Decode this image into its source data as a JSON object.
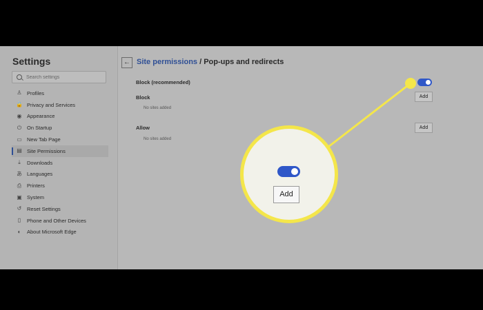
{
  "sidebar": {
    "title": "Settings",
    "search_placeholder": "Search settings",
    "items": [
      {
        "label": "Profiles",
        "icon": "person-icon",
        "glyph": "♙"
      },
      {
        "label": "Privacy and Services",
        "icon": "lock-icon",
        "glyph": "🔒"
      },
      {
        "label": "Appearance",
        "icon": "palette-icon",
        "glyph": "◉"
      },
      {
        "label": "On Startup",
        "icon": "power-icon",
        "glyph": "⏻"
      },
      {
        "label": "New Tab Page",
        "icon": "tab-icon",
        "glyph": "▭"
      },
      {
        "label": "Site Permissions",
        "icon": "permissions-icon",
        "glyph": "▤",
        "active": true
      },
      {
        "label": "Downloads",
        "icon": "download-icon",
        "glyph": "⤓"
      },
      {
        "label": "Languages",
        "icon": "language-icon",
        "glyph": "あ"
      },
      {
        "label": "Printers",
        "icon": "printer-icon",
        "glyph": "⎙"
      },
      {
        "label": "System",
        "icon": "system-icon",
        "glyph": "▣"
      },
      {
        "label": "Reset Settings",
        "icon": "reset-icon",
        "glyph": "↺"
      },
      {
        "label": "Phone and Other Devices",
        "icon": "phone-icon",
        "glyph": "▯"
      },
      {
        "label": "About Microsoft Edge",
        "icon": "edge-icon",
        "glyph": "◐"
      }
    ]
  },
  "main": {
    "breadcrumb_link": "Site permissions",
    "breadcrumb_rest": " / Pop-ups and redirects",
    "block_recommended_label": "Block (recommended)",
    "block_toggle_on": true,
    "block_section": {
      "title": "Block",
      "empty_text": "No sites added",
      "add_label": "Add"
    },
    "allow_section": {
      "title": "Allow",
      "empty_text": "No sites added",
      "add_label": "Add"
    }
  },
  "callout": {
    "add_label": "Add",
    "highlight_color": "#f4e64a",
    "toggle_color": "#2f57c8"
  }
}
